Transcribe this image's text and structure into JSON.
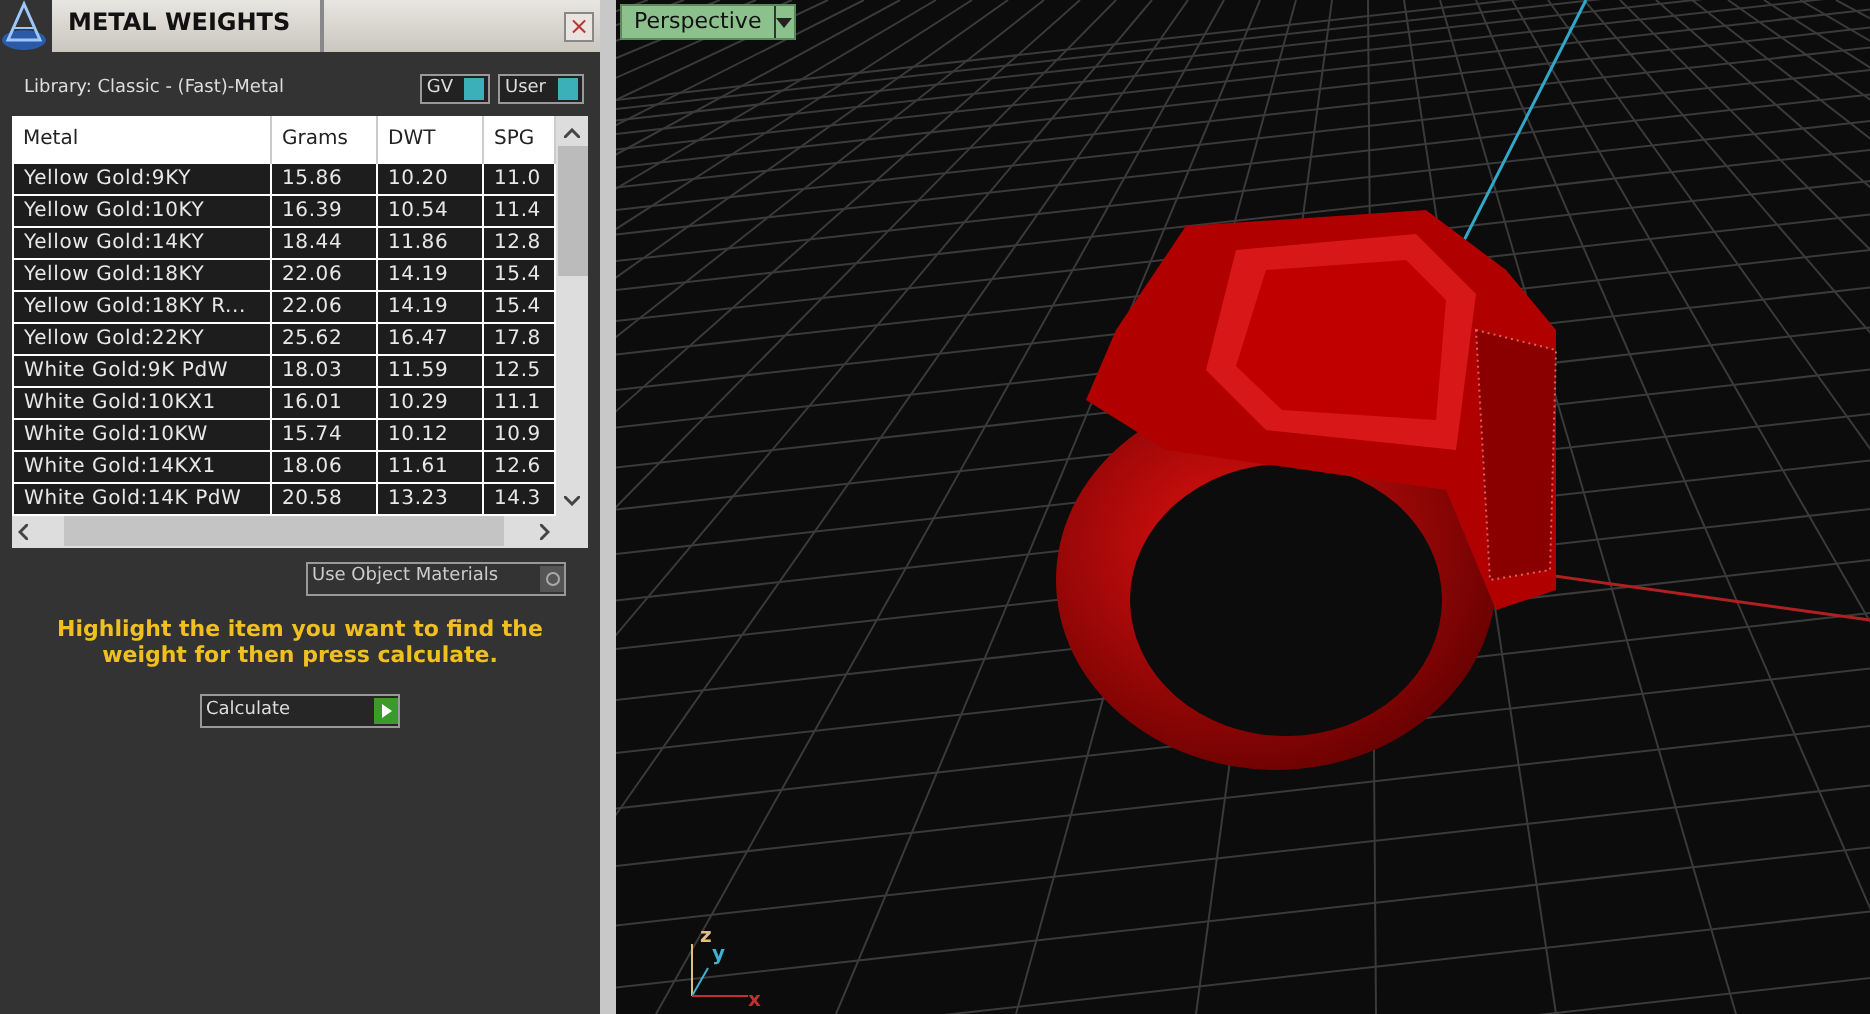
{
  "panel": {
    "title": "METAL WEIGHTS",
    "close": "×",
    "library": "Library: Classic - (Fast)-Metal",
    "toggles": [
      {
        "label": "GV",
        "on": true
      },
      {
        "label": "User",
        "on": true
      }
    ],
    "table": {
      "columns": [
        "Metal",
        "Grams",
        "DWT",
        "SPG"
      ],
      "rows": [
        {
          "cells": [
            "Yellow Gold:9KY",
            "15.86",
            "10.20",
            "11.0"
          ]
        },
        {
          "cells": [
            "Yellow Gold:10KY",
            "16.39",
            "10.54",
            "11.4"
          ]
        },
        {
          "cells": [
            "Yellow Gold:14KY",
            "18.44",
            "11.86",
            "12.8"
          ]
        },
        {
          "cells": [
            "Yellow Gold:18KY",
            "22.06",
            "14.19",
            "15.4"
          ]
        },
        {
          "cells": [
            "Yellow Gold:18KY R...",
            "22.06",
            "14.19",
            "15.4"
          ]
        },
        {
          "cells": [
            "Yellow Gold:22KY",
            "25.62",
            "16.47",
            "17.8"
          ]
        },
        {
          "cells": [
            "White Gold:9K PdW",
            "18.03",
            "11.59",
            "12.5"
          ]
        },
        {
          "cells": [
            "White Gold:10KX1",
            "16.01",
            "10.29",
            "11.1"
          ]
        },
        {
          "cells": [
            "White Gold:10KW",
            "15.74",
            "10.12",
            "10.9"
          ]
        },
        {
          "cells": [
            "White Gold:14KX1",
            "18.06",
            "11.61",
            "12.6"
          ]
        },
        {
          "cells": [
            "White Gold:14K PdW",
            "20.58",
            "13.23",
            "14.3"
          ]
        }
      ]
    },
    "option": {
      "label": "Use Object Materials",
      "checked": false
    },
    "hint": "Highlight the item you want to find the weight for then press calculate.",
    "action": "Calculate"
  },
  "viewport": {
    "view": "Perspective",
    "axes": [
      "z",
      "y",
      "x"
    ]
  }
}
